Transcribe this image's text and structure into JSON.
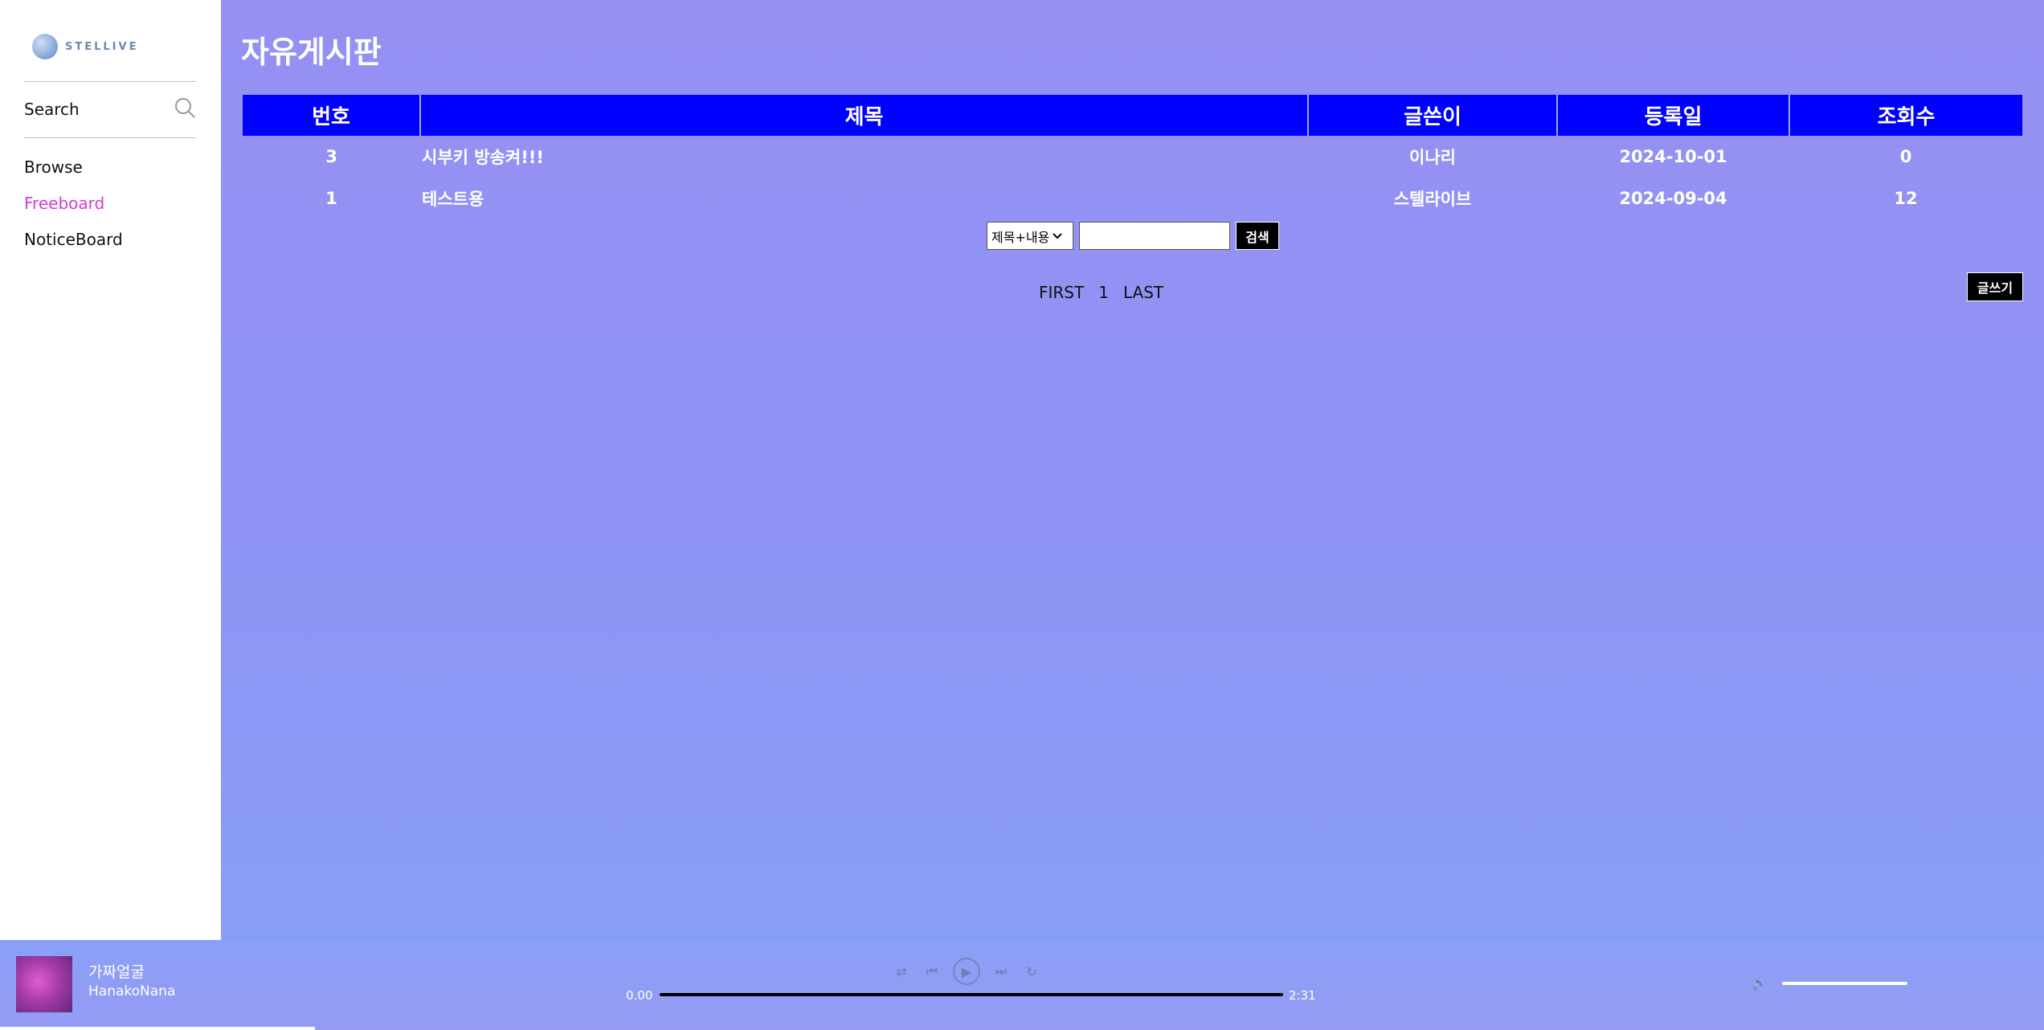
{
  "sidebar": {
    "logo_text": "STELLIVE",
    "search_label": "Search",
    "items": [
      {
        "label": "Browse",
        "active": false
      },
      {
        "label": "Freeboard",
        "active": true
      },
      {
        "label": "NoticeBoard",
        "active": false
      }
    ]
  },
  "main": {
    "title": "자유게시판",
    "table": {
      "headers": [
        "번호",
        "제목",
        "글쓴이",
        "등록일",
        "조회수"
      ],
      "rows": [
        {
          "no": "3",
          "title": "시부키 방송켜!!!",
          "author": "이나리",
          "date": "2024-10-01",
          "views": "0"
        },
        {
          "no": "1",
          "title": "테스트용",
          "author": "스텔라이브",
          "date": "2024-09-04",
          "views": "12"
        }
      ]
    },
    "search": {
      "select_value": "제목+내용",
      "input_value": "",
      "button_label": "검색"
    },
    "pagination": {
      "first": "FIRST",
      "page": "1",
      "last": "LAST"
    },
    "write_button": "글쓰기"
  },
  "player": {
    "track_title": "가짜얼굴",
    "artist": "HanakoNana",
    "current_time": "0.00",
    "duration": "2:31",
    "progress": 0
  },
  "colors": {
    "header_blue": "#0000ff",
    "active_nav": "#d53ad8",
    "background_top": "#9690f3",
    "background_bottom": "#879ff6"
  }
}
